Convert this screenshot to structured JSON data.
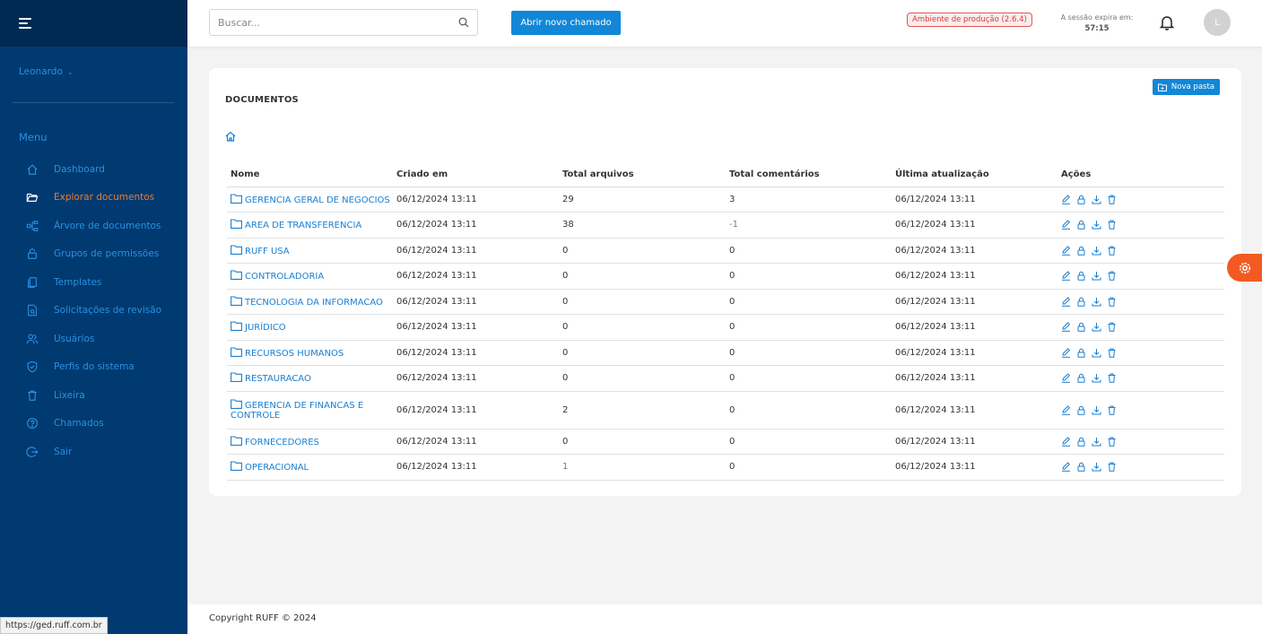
{
  "sidebar": {
    "user_name": "Leonardo",
    "menu_label": "Menu",
    "items": [
      {
        "label": "Dashboard",
        "icon": "home-icon"
      },
      {
        "label": "Explorar documentos",
        "icon": "folder-open-icon",
        "active": true
      },
      {
        "label": "Árvore de documentos",
        "icon": "tree-icon"
      },
      {
        "label": "Grupos de permissões",
        "icon": "lock-icon"
      },
      {
        "label": "Templates",
        "icon": "copy-icon"
      },
      {
        "label": "Solicitações de revisão",
        "icon": "file-review-icon"
      },
      {
        "label": "Usuários",
        "icon": "users-icon"
      },
      {
        "label": "Perfis do sistema",
        "icon": "shield-icon"
      },
      {
        "label": "Lixeira",
        "icon": "trash-icon"
      },
      {
        "label": "Chamados",
        "icon": "help-circle-icon"
      },
      {
        "label": "Sair",
        "icon": "logout-icon"
      }
    ]
  },
  "header": {
    "search_placeholder": "Buscar...",
    "new_ticket_label": "Abrir novo chamado",
    "env_badge": "Ambiente de produção (2.6.4)",
    "session_label": "A sessão expira em:",
    "session_time": "57:15",
    "avatar_initial": "L"
  },
  "documents": {
    "title": "DOCUMENTOS",
    "new_folder_label": "Nova pasta",
    "columns": [
      "Nome",
      "Criado em",
      "Total arquivos",
      "Total comentários",
      "Última atualização",
      "Ações"
    ],
    "rows": [
      {
        "name": "GERENCIA GERAL DE NEGOCIOS",
        "created": "06/12/2024 13:11",
        "files": "29",
        "comments": "3",
        "updated": "06/12/2024 13:11"
      },
      {
        "name": "AREA DE TRANSFERENCIA",
        "created": "06/12/2024 13:11",
        "files": "38",
        "comments": "-1",
        "updated": "06/12/2024 13:11"
      },
      {
        "name": "RUFF USA",
        "created": "06/12/2024 13:11",
        "files": "0",
        "comments": "0",
        "updated": "06/12/2024 13:11"
      },
      {
        "name": "CONTROLADORIA",
        "created": "06/12/2024 13:11",
        "files": "0",
        "comments": "0",
        "updated": "06/12/2024 13:11"
      },
      {
        "name": "TECNOLOGIA DA INFORMACAO",
        "created": "06/12/2024 13:11",
        "files": "0",
        "comments": "0",
        "updated": "06/12/2024 13:11"
      },
      {
        "name": "JURÍDICO",
        "created": "06/12/2024 13:11",
        "files": "0",
        "comments": "0",
        "updated": "06/12/2024 13:11"
      },
      {
        "name": "RECURSOS HUMANOS",
        "created": "06/12/2024 13:11",
        "files": "0",
        "comments": "0",
        "updated": "06/12/2024 13:11"
      },
      {
        "name": "RESTAURACAO",
        "created": "06/12/2024 13:11",
        "files": "0",
        "comments": "0",
        "updated": "06/12/2024 13:11"
      },
      {
        "name": "GERENCIA DE FINANCAS E CONTROLE",
        "created": "06/12/2024 13:11",
        "files": "2",
        "comments": "0",
        "updated": "06/12/2024 13:11"
      },
      {
        "name": "FORNECEDORES",
        "created": "06/12/2024 13:11",
        "files": "0",
        "comments": "0",
        "updated": "06/12/2024 13:11"
      },
      {
        "name": "OPERACIONAL",
        "created": "06/12/2024 13:11",
        "files": "1",
        "comments": "0",
        "updated": "06/12/2024 13:11"
      }
    ]
  },
  "footer": {
    "copyright": "Copyright RUFF © 2024",
    "status_url": "https://ged.ruff.com.br"
  },
  "colors": {
    "sidebar_bg": "#003a70",
    "accent": "#1287d8",
    "active": "#f07a2a",
    "float": "#f25a22"
  }
}
